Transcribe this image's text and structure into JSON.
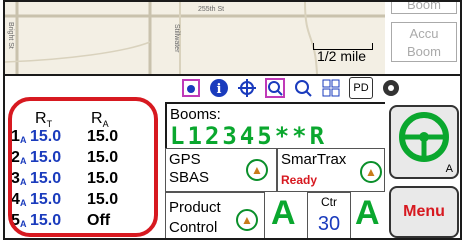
{
  "map": {
    "road_left": "Bright St",
    "road_top": "255th St",
    "road_vertical": "Stillwater",
    "scale_label": "1/2 mile"
  },
  "top_right": {
    "top_label": "Boom",
    "accu_label": "Accu",
    "boom_label": "Boom"
  },
  "toolbar": {
    "icons": [
      "vehicle-view-icon",
      "info-icon",
      "gps-target-icon",
      "zoom-in-icon",
      "zoom-out-icon",
      "grid-icon",
      "pd-icon",
      "settings-icon"
    ],
    "pd_text": "D"
  },
  "ratio": {
    "rt_header": "R",
    "rt_sub": "T",
    "ra_header": "R",
    "ra_sub": "A",
    "rows": [
      {
        "num": "1",
        "sub": "A",
        "rt": "15.0",
        "ra": "15.0"
      },
      {
        "num": "2",
        "sub": "A",
        "rt": "15.0",
        "ra": "15.0"
      },
      {
        "num": "3",
        "sub": "A",
        "rt": "15.0",
        "ra": "15.0"
      },
      {
        "num": "4",
        "sub": "A",
        "rt": "15.0",
        "ra": "15.0"
      },
      {
        "num": "5",
        "sub": "A",
        "rt": "15.0",
        "ra": "Off"
      }
    ]
  },
  "booms": {
    "label": "Booms:",
    "value": "L12345**R"
  },
  "gps": {
    "line1": "GPS",
    "line2": "SBAS"
  },
  "smartrax": {
    "label": "SmarTrax",
    "status": "Ready"
  },
  "product": {
    "line1": "Product",
    "line2": "Control",
    "ctr_label": "Ctr",
    "ctr_value": "30",
    "left_mode": "A",
    "right_mode": "A"
  },
  "steer": {
    "mode": "A"
  },
  "menu": {
    "label": "Menu"
  }
}
